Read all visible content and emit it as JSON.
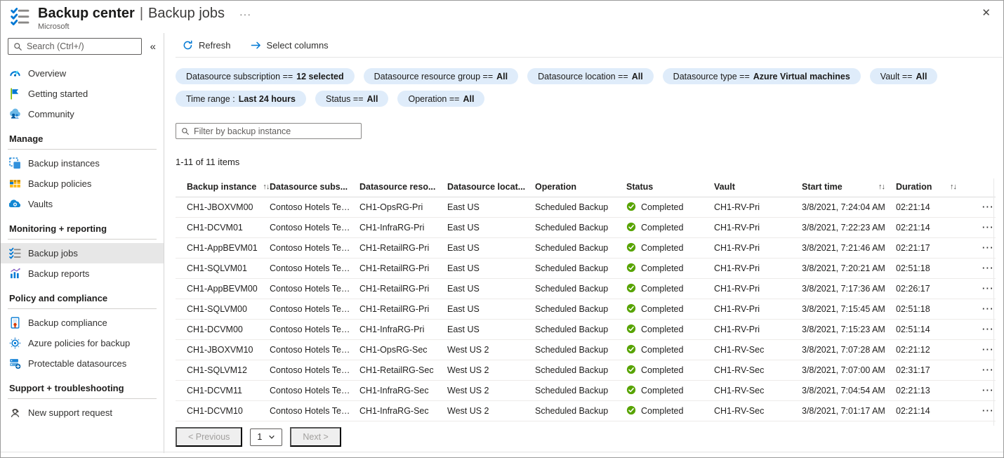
{
  "header": {
    "title": "Backup center",
    "separator": "|",
    "page": "Backup jobs",
    "publisher": "Microsoft",
    "more_icon": "···",
    "close_icon": "✕"
  },
  "sidebar": {
    "search": {
      "placeholder": "Search (Ctrl+/)"
    },
    "collapse_icon": "«",
    "top_items": [
      {
        "label": "Overview",
        "icon": "overview-icon"
      },
      {
        "label": "Getting started",
        "icon": "flag-icon"
      },
      {
        "label": "Community",
        "icon": "community-icon"
      }
    ],
    "sections": [
      {
        "label": "Manage",
        "items": [
          {
            "label": "Backup instances",
            "icon": "backup-instances-icon"
          },
          {
            "label": "Backup policies",
            "icon": "backup-policies-icon"
          },
          {
            "label": "Vaults",
            "icon": "vault-icon"
          }
        ]
      },
      {
        "label": "Monitoring + reporting",
        "items": [
          {
            "label": "Backup jobs",
            "icon": "checklist-icon",
            "selected": true
          },
          {
            "label": "Backup reports",
            "icon": "chart-icon"
          }
        ]
      },
      {
        "label": "Policy and compliance",
        "items": [
          {
            "label": "Backup compliance",
            "icon": "document-check-icon"
          },
          {
            "label": "Azure policies for backup",
            "icon": "policy-icon"
          },
          {
            "label": "Protectable datasources",
            "icon": "datasource-icon"
          }
        ]
      },
      {
        "label": "Support + troubleshooting",
        "items": [
          {
            "label": "New support request",
            "icon": "support-person-icon"
          }
        ]
      }
    ]
  },
  "toolbar": {
    "refresh_label": "Refresh",
    "select_columns_label": "Select columns"
  },
  "filters": {
    "row1": [
      {
        "label": "Datasource subscription ==",
        "value": "12 selected"
      },
      {
        "label": "Datasource resource group ==",
        "value": "All"
      },
      {
        "label": "Datasource location ==",
        "value": "All"
      },
      {
        "label": "Datasource type ==",
        "value": "Azure Virtual machines"
      },
      {
        "label": "Vault ==",
        "value": "All"
      }
    ],
    "row2": [
      {
        "label": "Time range :",
        "value": "Last 24 hours"
      },
      {
        "label": "Status ==",
        "value": "All"
      },
      {
        "label": "Operation ==",
        "value": "All"
      }
    ]
  },
  "instance_filter": {
    "placeholder": "Filter by backup instance"
  },
  "items_count": "1-11 of 11 items",
  "table": {
    "sort_icon": "↑↓",
    "actions_icon": "···",
    "columns": [
      {
        "label": "Backup instance",
        "sortable": true
      },
      {
        "label": "Datasource subs...",
        "sortable": false
      },
      {
        "label": "Datasource reso...",
        "sortable": false
      },
      {
        "label": "Datasource locat...",
        "sortable": false
      },
      {
        "label": "Operation",
        "sortable": false
      },
      {
        "label": "Status",
        "sortable": false
      },
      {
        "label": "Vault",
        "sortable": false
      },
      {
        "label": "Start time",
        "sortable": true,
        "sort_right": true
      },
      {
        "label": "Duration",
        "sortable": true,
        "sort_right": true
      }
    ],
    "rows": [
      {
        "instance": "CH1-JBOXVM00",
        "subscription": "Contoso Hotels Tena...",
        "resource_group": "CH1-OpsRG-Pri",
        "location": "East US",
        "operation": "Scheduled Backup",
        "status": "Completed",
        "vault": "CH1-RV-Pri",
        "start_time": "3/8/2021, 7:24:04 AM",
        "duration": "02:21:14"
      },
      {
        "instance": "CH1-DCVM01",
        "subscription": "Contoso Hotels Tena...",
        "resource_group": "CH1-InfraRG-Pri",
        "location": "East US",
        "operation": "Scheduled Backup",
        "status": "Completed",
        "vault": "CH1-RV-Pri",
        "start_time": "3/8/2021, 7:22:23 AM",
        "duration": "02:21:14"
      },
      {
        "instance": "CH1-AppBEVM01",
        "subscription": "Contoso Hotels Tena...",
        "resource_group": "CH1-RetailRG-Pri",
        "location": "East US",
        "operation": "Scheduled Backup",
        "status": "Completed",
        "vault": "CH1-RV-Pri",
        "start_time": "3/8/2021, 7:21:46 AM",
        "duration": "02:21:17"
      },
      {
        "instance": "CH1-SQLVM01",
        "subscription": "Contoso Hotels Tena...",
        "resource_group": "CH1-RetailRG-Pri",
        "location": "East US",
        "operation": "Scheduled Backup",
        "status": "Completed",
        "vault": "CH1-RV-Pri",
        "start_time": "3/8/2021, 7:20:21 AM",
        "duration": "02:51:18"
      },
      {
        "instance": "CH1-AppBEVM00",
        "subscription": "Contoso Hotels Tena...",
        "resource_group": "CH1-RetailRG-Pri",
        "location": "East US",
        "operation": "Scheduled Backup",
        "status": "Completed",
        "vault": "CH1-RV-Pri",
        "start_time": "3/8/2021, 7:17:36 AM",
        "duration": "02:26:17"
      },
      {
        "instance": "CH1-SQLVM00",
        "subscription": "Contoso Hotels Tena...",
        "resource_group": "CH1-RetailRG-Pri",
        "location": "East US",
        "operation": "Scheduled Backup",
        "status": "Completed",
        "vault": "CH1-RV-Pri",
        "start_time": "3/8/2021, 7:15:45 AM",
        "duration": "02:51:18"
      },
      {
        "instance": "CH1-DCVM00",
        "subscription": "Contoso Hotels Tena...",
        "resource_group": "CH1-InfraRG-Pri",
        "location": "East US",
        "operation": "Scheduled Backup",
        "status": "Completed",
        "vault": "CH1-RV-Pri",
        "start_time": "3/8/2021, 7:15:23 AM",
        "duration": "02:51:14"
      },
      {
        "instance": "CH1-JBOXVM10",
        "subscription": "Contoso Hotels Tena...",
        "resource_group": "CH1-OpsRG-Sec",
        "location": "West US 2",
        "operation": "Scheduled Backup",
        "status": "Completed",
        "vault": "CH1-RV-Sec",
        "start_time": "3/8/2021, 7:07:28 AM",
        "duration": "02:21:12"
      },
      {
        "instance": "CH1-SQLVM12",
        "subscription": "Contoso Hotels Tena...",
        "resource_group": "CH1-RetailRG-Sec",
        "location": "West US 2",
        "operation": "Scheduled Backup",
        "status": "Completed",
        "vault": "CH1-RV-Sec",
        "start_time": "3/8/2021, 7:07:00 AM",
        "duration": "02:31:17"
      },
      {
        "instance": "CH1-DCVM11",
        "subscription": "Contoso Hotels Tena...",
        "resource_group": "CH1-InfraRG-Sec",
        "location": "West US 2",
        "operation": "Scheduled Backup",
        "status": "Completed",
        "vault": "CH1-RV-Sec",
        "start_time": "3/8/2021, 7:04:54 AM",
        "duration": "02:21:13"
      },
      {
        "instance": "CH1-DCVM10",
        "subscription": "Contoso Hotels Tena...",
        "resource_group": "CH1-InfraRG-Sec",
        "location": "West US 2",
        "operation": "Scheduled Backup",
        "status": "Completed",
        "vault": "CH1-RV-Sec",
        "start_time": "3/8/2021, 7:01:17 AM",
        "duration": "02:21:14"
      }
    ]
  },
  "pagination": {
    "previous_label": "< Previous",
    "page_value": "1",
    "next_label": "Next >"
  },
  "colors": {
    "accent": "#0078d4",
    "pill_background": "#dfecfa",
    "status_completed": "#57a300",
    "selected_item_background": "#e7e7e7"
  }
}
